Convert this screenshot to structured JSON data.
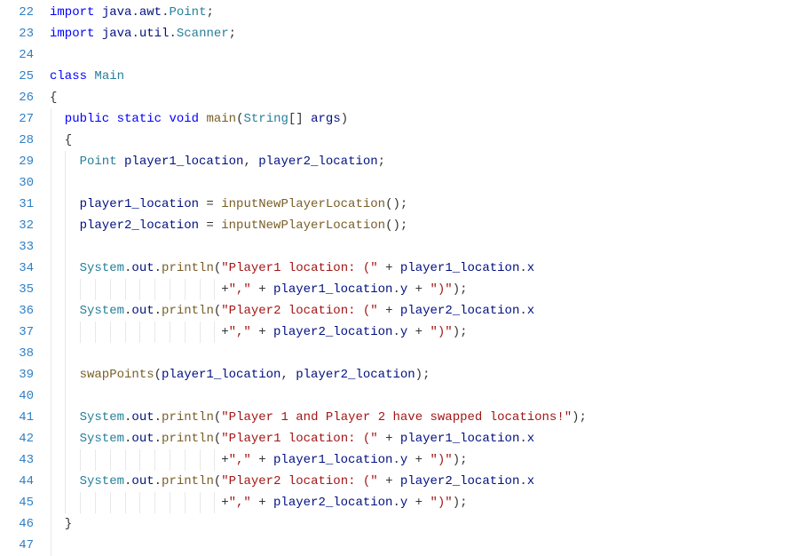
{
  "startLine": 22,
  "lines": [
    {
      "indent": 0,
      "guides": [],
      "tokens": [
        [
          "k",
          "import"
        ],
        [
          "p",
          " "
        ],
        [
          "id",
          "java"
        ],
        [
          "p",
          "."
        ],
        [
          "id",
          "awt"
        ],
        [
          "p",
          "."
        ],
        [
          "t",
          "Point"
        ],
        [
          "p",
          ";"
        ]
      ]
    },
    {
      "indent": 0,
      "guides": [],
      "tokens": [
        [
          "k",
          "import"
        ],
        [
          "p",
          " "
        ],
        [
          "id",
          "java"
        ],
        [
          "p",
          "."
        ],
        [
          "id",
          "util"
        ],
        [
          "p",
          "."
        ],
        [
          "t",
          "Scanner"
        ],
        [
          "p",
          ";"
        ]
      ]
    },
    {
      "indent": 0,
      "guides": [],
      "tokens": []
    },
    {
      "indent": 0,
      "guides": [],
      "tokens": [
        [
          "k",
          "class"
        ],
        [
          "p",
          " "
        ],
        [
          "t",
          "Main"
        ]
      ]
    },
    {
      "indent": 0,
      "guides": [],
      "tokens": [
        [
          "p",
          "{"
        ]
      ]
    },
    {
      "indent": 2,
      "guides": [
        0
      ],
      "tokens": [
        [
          "k",
          "public"
        ],
        [
          "p",
          " "
        ],
        [
          "k",
          "static"
        ],
        [
          "p",
          " "
        ],
        [
          "k",
          "void"
        ],
        [
          "p",
          " "
        ],
        [
          "m",
          "main"
        ],
        [
          "p",
          "("
        ],
        [
          "t",
          "String"
        ],
        [
          "p",
          "[] "
        ],
        [
          "id",
          "args"
        ],
        [
          "p",
          ")"
        ]
      ]
    },
    {
      "indent": 2,
      "guides": [
        0
      ],
      "tokens": [
        [
          "p",
          "{"
        ]
      ]
    },
    {
      "indent": 4,
      "guides": [
        0,
        2
      ],
      "tokens": [
        [
          "t",
          "Point"
        ],
        [
          "p",
          " "
        ],
        [
          "id",
          "player1_location"
        ],
        [
          "p",
          ", "
        ],
        [
          "id",
          "player2_location"
        ],
        [
          "p",
          ";"
        ]
      ]
    },
    {
      "indent": 4,
      "guides": [
        0,
        2
      ],
      "tokens": []
    },
    {
      "indent": 4,
      "guides": [
        0,
        2
      ],
      "tokens": [
        [
          "id",
          "player1_location"
        ],
        [
          "p",
          " = "
        ],
        [
          "m",
          "inputNewPlayerLocation"
        ],
        [
          "p",
          "();"
        ]
      ]
    },
    {
      "indent": 4,
      "guides": [
        0,
        2
      ],
      "tokens": [
        [
          "id",
          "player2_location"
        ],
        [
          "p",
          " = "
        ],
        [
          "m",
          "inputNewPlayerLocation"
        ],
        [
          "p",
          "();"
        ]
      ]
    },
    {
      "indent": 4,
      "guides": [
        0,
        2
      ],
      "tokens": []
    },
    {
      "indent": 4,
      "guides": [
        0,
        2
      ],
      "tokens": [
        [
          "t",
          "System"
        ],
        [
          "p",
          "."
        ],
        [
          "id",
          "out"
        ],
        [
          "p",
          "."
        ],
        [
          "m",
          "println"
        ],
        [
          "p",
          "("
        ],
        [
          "s",
          "\"Player1 location: (\""
        ],
        [
          "p",
          " + "
        ],
        [
          "id",
          "player1_location"
        ],
        [
          "p",
          "."
        ],
        [
          "id",
          "x"
        ]
      ]
    },
    {
      "indent": 23,
      "guides": [
        0,
        2,
        4,
        6,
        8,
        10,
        12,
        14,
        16,
        18,
        20,
        22
      ],
      "tokens": [
        [
          "p",
          "+"
        ],
        [
          "s",
          "\",\""
        ],
        [
          "p",
          " + "
        ],
        [
          "id",
          "player1_location"
        ],
        [
          "p",
          "."
        ],
        [
          "id",
          "y"
        ],
        [
          "p",
          " + "
        ],
        [
          "s",
          "\")\""
        ],
        [
          "p",
          ");"
        ]
      ]
    },
    {
      "indent": 4,
      "guides": [
        0,
        2
      ],
      "tokens": [
        [
          "t",
          "System"
        ],
        [
          "p",
          "."
        ],
        [
          "id",
          "out"
        ],
        [
          "p",
          "."
        ],
        [
          "m",
          "println"
        ],
        [
          "p",
          "("
        ],
        [
          "s",
          "\"Player2 location: (\""
        ],
        [
          "p",
          " + "
        ],
        [
          "id",
          "player2_location"
        ],
        [
          "p",
          "."
        ],
        [
          "id",
          "x"
        ]
      ]
    },
    {
      "indent": 23,
      "guides": [
        0,
        2,
        4,
        6,
        8,
        10,
        12,
        14,
        16,
        18,
        20,
        22
      ],
      "tokens": [
        [
          "p",
          "+"
        ],
        [
          "s",
          "\",\""
        ],
        [
          "p",
          " + "
        ],
        [
          "id",
          "player2_location"
        ],
        [
          "p",
          "."
        ],
        [
          "id",
          "y"
        ],
        [
          "p",
          " + "
        ],
        [
          "s",
          "\")\""
        ],
        [
          "p",
          ");"
        ]
      ]
    },
    {
      "indent": 4,
      "guides": [
        0,
        2
      ],
      "tokens": []
    },
    {
      "indent": 4,
      "guides": [
        0,
        2
      ],
      "tokens": [
        [
          "m",
          "swapPoints"
        ],
        [
          "p",
          "("
        ],
        [
          "id",
          "player1_location"
        ],
        [
          "p",
          ", "
        ],
        [
          "id",
          "player2_location"
        ],
        [
          "p",
          ");"
        ]
      ]
    },
    {
      "indent": 4,
      "guides": [
        0,
        2
      ],
      "tokens": []
    },
    {
      "indent": 4,
      "guides": [
        0,
        2
      ],
      "tokens": [
        [
          "t",
          "System"
        ],
        [
          "p",
          "."
        ],
        [
          "id",
          "out"
        ],
        [
          "p",
          "."
        ],
        [
          "m",
          "println"
        ],
        [
          "p",
          "("
        ],
        [
          "s",
          "\"Player 1 and Player 2 have swapped locations!\""
        ],
        [
          "p",
          ");"
        ]
      ]
    },
    {
      "indent": 4,
      "guides": [
        0,
        2
      ],
      "tokens": [
        [
          "t",
          "System"
        ],
        [
          "p",
          "."
        ],
        [
          "id",
          "out"
        ],
        [
          "p",
          "."
        ],
        [
          "m",
          "println"
        ],
        [
          "p",
          "("
        ],
        [
          "s",
          "\"Player1 location: (\""
        ],
        [
          "p",
          " + "
        ],
        [
          "id",
          "player1_location"
        ],
        [
          "p",
          "."
        ],
        [
          "id",
          "x"
        ]
      ]
    },
    {
      "indent": 23,
      "guides": [
        0,
        2,
        4,
        6,
        8,
        10,
        12,
        14,
        16,
        18,
        20,
        22
      ],
      "tokens": [
        [
          "p",
          "+"
        ],
        [
          "s",
          "\",\""
        ],
        [
          "p",
          " + "
        ],
        [
          "id",
          "player1_location"
        ],
        [
          "p",
          "."
        ],
        [
          "id",
          "y"
        ],
        [
          "p",
          " + "
        ],
        [
          "s",
          "\")\""
        ],
        [
          "p",
          ");"
        ]
      ]
    },
    {
      "indent": 4,
      "guides": [
        0,
        2
      ],
      "tokens": [
        [
          "t",
          "System"
        ],
        [
          "p",
          "."
        ],
        [
          "id",
          "out"
        ],
        [
          "p",
          "."
        ],
        [
          "m",
          "println"
        ],
        [
          "p",
          "("
        ],
        [
          "s",
          "\"Player2 location: (\""
        ],
        [
          "p",
          " + "
        ],
        [
          "id",
          "player2_location"
        ],
        [
          "p",
          "."
        ],
        [
          "id",
          "x"
        ]
      ]
    },
    {
      "indent": 23,
      "guides": [
        0,
        2,
        4,
        6,
        8,
        10,
        12,
        14,
        16,
        18,
        20,
        22
      ],
      "tokens": [
        [
          "p",
          "+"
        ],
        [
          "s",
          "\",\""
        ],
        [
          "p",
          " + "
        ],
        [
          "id",
          "player2_location"
        ],
        [
          "p",
          "."
        ],
        [
          "id",
          "y"
        ],
        [
          "p",
          " + "
        ],
        [
          "s",
          "\")\""
        ],
        [
          "p",
          ");"
        ]
      ]
    },
    {
      "indent": 2,
      "guides": [
        0
      ],
      "tokens": [
        [
          "p",
          "}"
        ]
      ]
    },
    {
      "indent": 2,
      "guides": [
        0
      ],
      "tokens": []
    }
  ],
  "charWidth": 8.4
}
